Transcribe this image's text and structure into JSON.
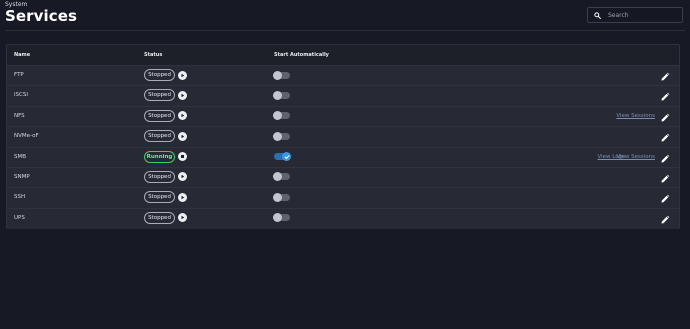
{
  "header": {
    "breadcrumb": "System",
    "title": "Services"
  },
  "search": {
    "placeholder": "Search"
  },
  "table": {
    "columns": {
      "name": "Name",
      "status": "Status",
      "start": "Start Automatically"
    },
    "rows": [
      {
        "name": "FTP",
        "status": "Stopped",
        "running": false,
        "auto_start": false,
        "links": []
      },
      {
        "name": "iSCSI",
        "status": "Stopped",
        "running": false,
        "auto_start": false,
        "links": []
      },
      {
        "name": "NFS",
        "status": "Stopped",
        "running": false,
        "auto_start": false,
        "links": [
          "View Sessions"
        ]
      },
      {
        "name": "NVMe-oF",
        "status": "Stopped",
        "running": false,
        "auto_start": false,
        "links": []
      },
      {
        "name": "SMB",
        "status": "Running",
        "running": true,
        "auto_start": true,
        "links": [
          "View Logs",
          "View Sessions"
        ]
      },
      {
        "name": "SNMP",
        "status": "Stopped",
        "running": false,
        "auto_start": false,
        "links": []
      },
      {
        "name": "SSH",
        "status": "Stopped",
        "running": false,
        "auto_start": false,
        "links": []
      },
      {
        "name": "UPS",
        "status": "Stopped",
        "running": false,
        "auto_start": false,
        "links": []
      }
    ]
  },
  "icons": {
    "search": "search-icon",
    "start": "play-icon",
    "stop": "stop-icon",
    "edit": "pencil-icon",
    "check": "check-icon"
  },
  "colors": {
    "background": "#171924",
    "row": "#272a34",
    "running": "#36d16b",
    "toggle_on": "#2c6eb0",
    "link": "#7b8db5"
  }
}
